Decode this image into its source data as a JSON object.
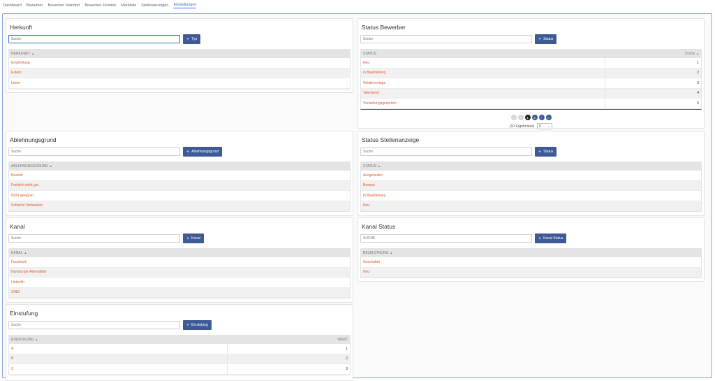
{
  "nav": {
    "items": [
      "Dashboard",
      "Bewerber",
      "Bewerber Standort",
      "Bewerber-Termine",
      "Merkliste",
      "Stellenanzeigen",
      "Einstellungen"
    ],
    "active_index": 6
  },
  "cards": {
    "herkunft": {
      "title": "Herkunft",
      "search_placeholder": "Suche",
      "add_label": "Typ",
      "header": "HERKUNFT",
      "rows": [
        "Empfehlung",
        "Extern",
        "Intern"
      ]
    },
    "status_bewerber": {
      "title": "Status Bewerber",
      "search_placeholder": "Suche",
      "add_label": "Status",
      "header_status": "STATUS",
      "header_code": "CODE",
      "rows": [
        {
          "status": "Neu",
          "code": "1"
        },
        {
          "status": "in Bearbeitung",
          "code": "2"
        },
        {
          "status": "Wiedervorlage",
          "code": "3"
        },
        {
          "status": "Talentpool",
          "code": "4"
        },
        {
          "status": "Vorstellungsgespräch",
          "code": "5"
        }
      ],
      "pager": {
        "pages": [
          "1",
          "2"
        ],
        "results": "(10 Ergebnisse)",
        "page_size": "5"
      }
    },
    "ablehnungsgrund": {
      "title": "Ablehnungsgrund",
      "search_placeholder": "Suche",
      "add_label": "Ablehnungsgrund",
      "header": "ABLEHNUNGSGRUND",
      "rows": [
        "Besetzt",
        "Fachlich nicht gut",
        "Nicht geeignet",
        "Schlecht Vorbereitet"
      ]
    },
    "status_stellenanzeige": {
      "title": "Status Stellenanzeige",
      "search_placeholder": "Suche",
      "add_label": "Status",
      "header": "STATUS",
      "rows": [
        "Ausgelaufen",
        "Besetzt",
        "in Bearbeitung",
        "Neu"
      ]
    },
    "kanal": {
      "title": "Kanal",
      "search_placeholder": "Suche",
      "add_label": "Kanal",
      "header": "KANAL",
      "rows": [
        "Facebook",
        "Hamburger Abendblatt",
        "LinkedIn",
        "XING"
      ]
    },
    "kanal_status": {
      "title": "Kanal Status",
      "search_placeholder": "SUCHE",
      "add_label": "Kanal Status",
      "header": "BEZEICHNUNG",
      "rows": [
        "Geschaltet",
        "Neu"
      ]
    },
    "einstufung": {
      "title": "Einstufung",
      "search_placeholder": "Suche",
      "add_label": "Einstufung",
      "header_name": "EINSTUFUNG",
      "header_value": "WERT",
      "rows": [
        {
          "name": "A",
          "value": "1"
        },
        {
          "name": "B",
          "value": "2"
        },
        {
          "name": "C",
          "value": "3"
        }
      ]
    }
  },
  "colors": {
    "accent": "#3d5a96",
    "link": "#e0582a",
    "active_nav": "#3a6fc0"
  }
}
